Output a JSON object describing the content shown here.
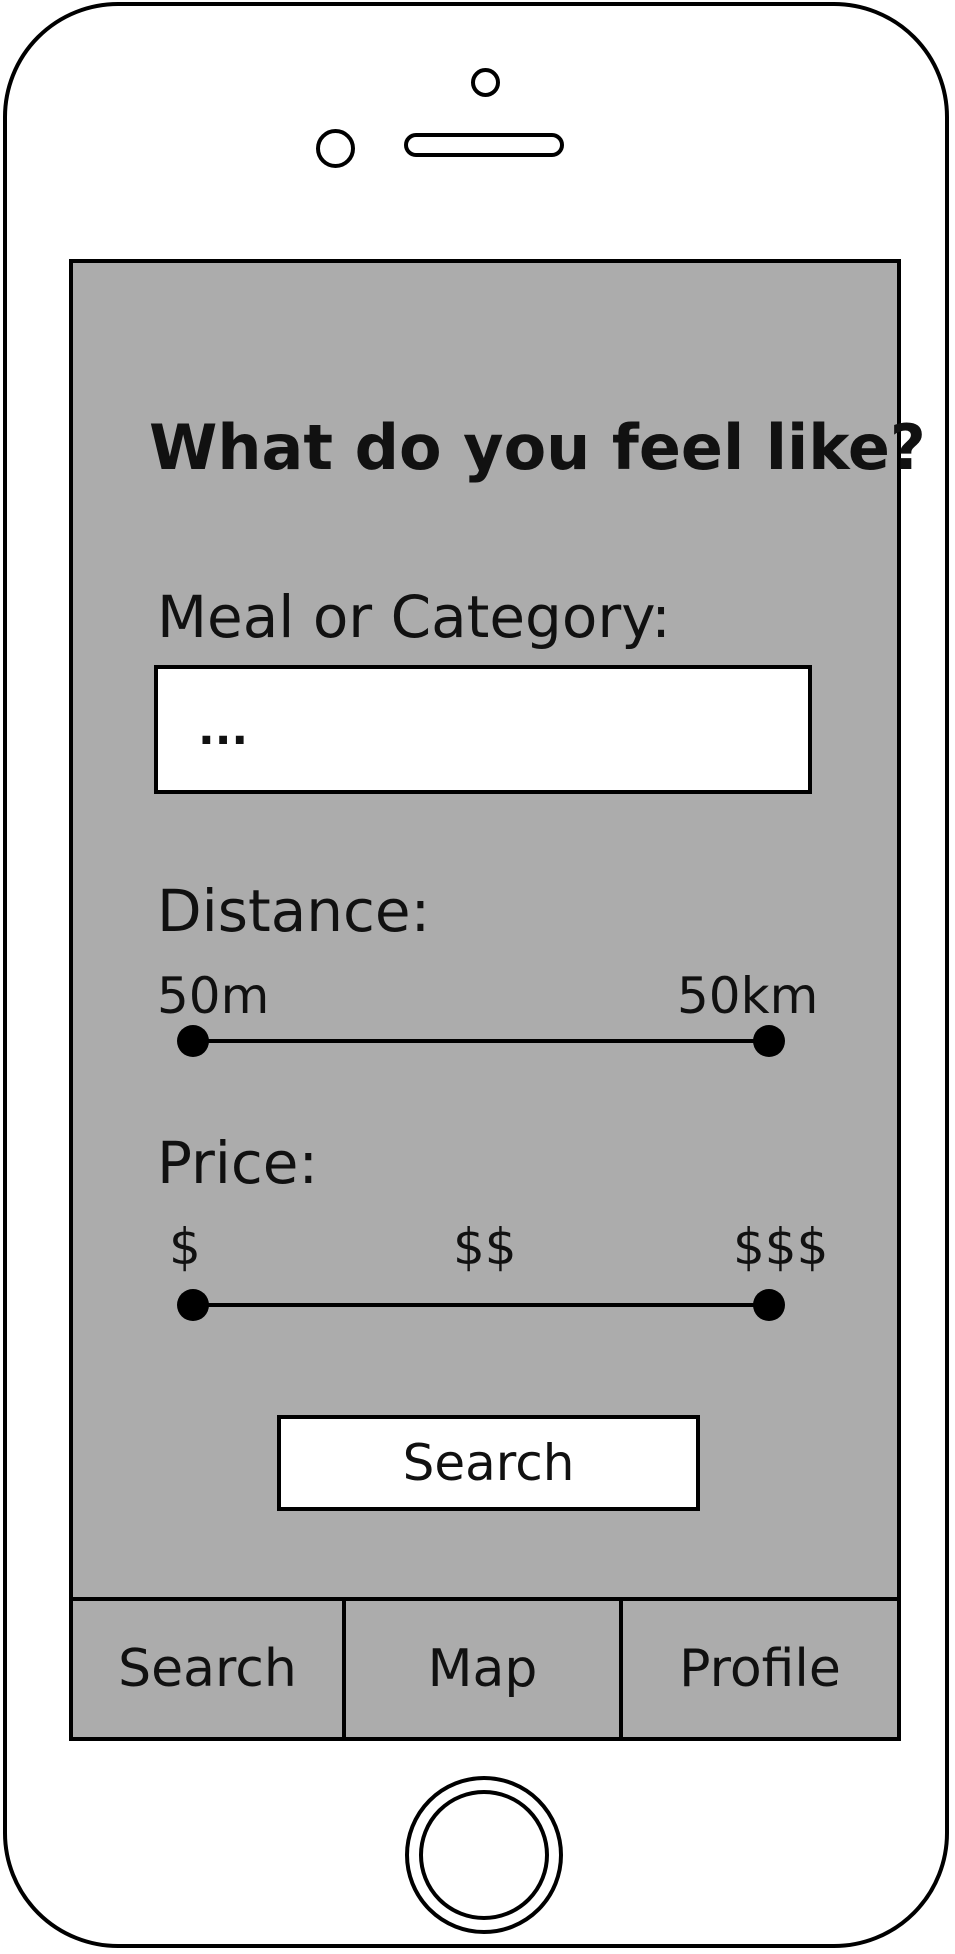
{
  "header": {
    "title": "What do you feel like?"
  },
  "meal": {
    "label": "Meal or Category:",
    "placeholder": "...",
    "value": ""
  },
  "distance": {
    "label": "Distance:",
    "min_label": "50m",
    "max_label": "50km"
  },
  "price": {
    "label": "Price:",
    "tick_low": "$",
    "tick_mid": "$$",
    "tick_high": "$$$"
  },
  "actions": {
    "search_label": "Search"
  },
  "tabs": [
    {
      "label": "Search"
    },
    {
      "label": "Map"
    },
    {
      "label": "Profile"
    }
  ],
  "colors": {
    "screen_background": "#acacac",
    "outline": "#000000"
  }
}
